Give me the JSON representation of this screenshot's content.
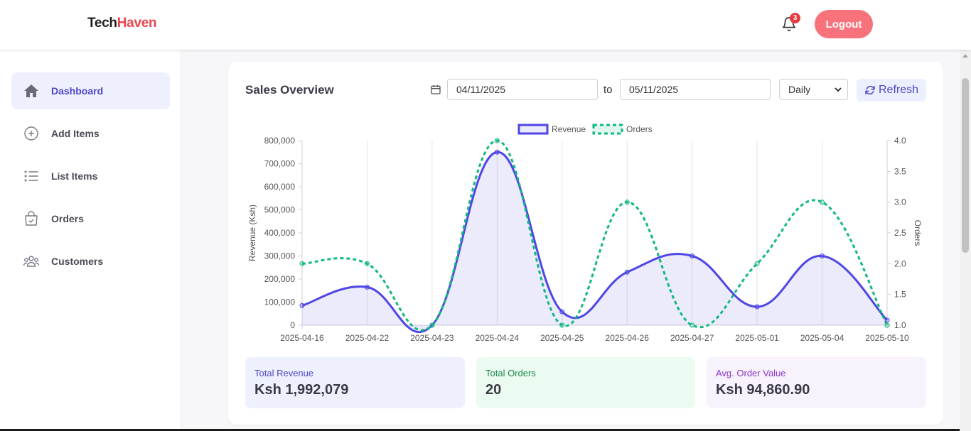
{
  "header": {
    "logo_part1": "Tech",
    "logo_part2": "Haven",
    "notification_count": "3",
    "logout_label": "Logout"
  },
  "sidebar": {
    "items": [
      {
        "label": "Dashboard",
        "icon": "home-icon",
        "active": true
      },
      {
        "label": "Add Items",
        "icon": "plus-circle-icon",
        "active": false
      },
      {
        "label": "List Items",
        "icon": "list-icon",
        "active": false
      },
      {
        "label": "Orders",
        "icon": "shopping-bag-icon",
        "active": false
      },
      {
        "label": "Customers",
        "icon": "users-icon",
        "active": false
      }
    ]
  },
  "sales": {
    "title": "Sales Overview",
    "start_date": "04/11/2025",
    "to_label": "to",
    "end_date": "05/11/2025",
    "period": "Daily",
    "refresh_label": "Refresh"
  },
  "stats": {
    "revenue_label": "Total Revenue",
    "revenue_value": "Ksh 1,992,079",
    "orders_label": "Total Orders",
    "orders_value": "20",
    "aov_label": "Avg. Order Value",
    "aov_value": "Ksh 94,860.90"
  },
  "colors": {
    "accent": "#4f46c8",
    "revenue_line": "#4f46e5",
    "orders_line": "#10b981",
    "logout": "#f7727a",
    "brand_red": "#e8474d"
  },
  "chart_data": {
    "type": "line",
    "categories": [
      "2025-04-16",
      "2025-04-22",
      "2025-04-23",
      "2025-04-24",
      "2025-04-25",
      "2025-04-26",
      "2025-04-27",
      "2025-05-01",
      "2025-05-04",
      "2025-05-10"
    ],
    "series": [
      {
        "name": "Revenue",
        "axis": "left",
        "style": "solid-filled",
        "values": [
          85000,
          165000,
          0,
          750000,
          58000,
          230000,
          300000,
          80000,
          300000,
          22000
        ]
      },
      {
        "name": "Orders",
        "axis": "right",
        "style": "dashed",
        "values": [
          2,
          2,
          1,
          4,
          1,
          3,
          1,
          2,
          3,
          1
        ]
      }
    ],
    "ylabel": "Revenue (Ksh)",
    "y2label": "Orders",
    "ylim": [
      0,
      800000
    ],
    "y2lim": [
      1,
      4
    ],
    "yticks": [
      "0",
      "100,000",
      "200,000",
      "300,000",
      "400,000",
      "500,000",
      "600,000",
      "700,000",
      "800,000"
    ],
    "y2ticks": [
      "1.0",
      "1.5",
      "2.0",
      "2.5",
      "3.0",
      "3.5",
      "4.0"
    ],
    "legend": "top-center",
    "grid": "vertical"
  }
}
